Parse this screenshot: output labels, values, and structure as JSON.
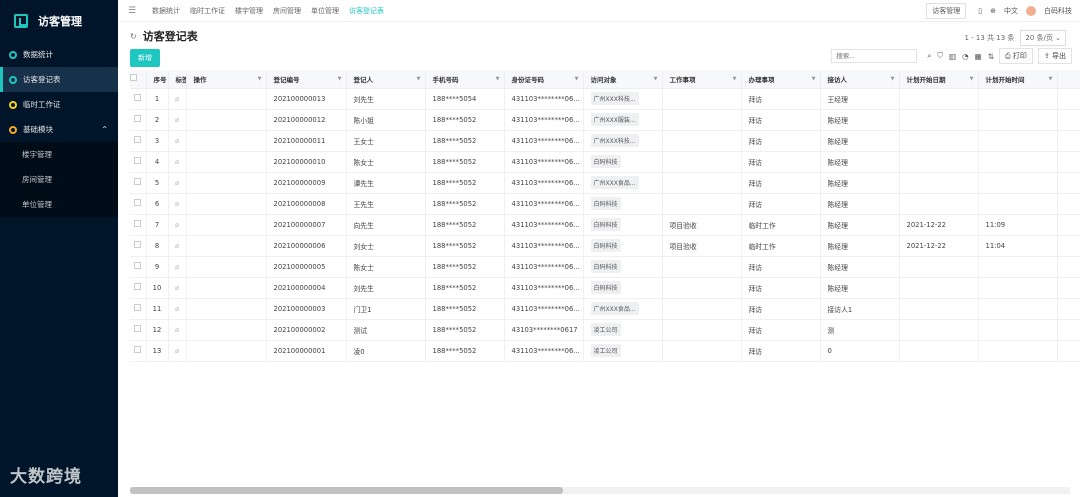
{
  "app": {
    "title": "访客管理",
    "watermark": "大数跨境"
  },
  "sidebar": {
    "items": [
      {
        "label": "数据统计"
      },
      {
        "label": "访客登记表"
      },
      {
        "label": "临时工作证"
      },
      {
        "label": "基础模块"
      }
    ],
    "subitems": [
      {
        "label": "楼宇管理"
      },
      {
        "label": "房间管理"
      },
      {
        "label": "单位管理"
      }
    ]
  },
  "topnav": {
    "tabs": [
      "数据统计",
      "临时工作证",
      "楼宇管理",
      "房间管理",
      "单位管理",
      "访客登记表"
    ],
    "active_tab": "访客登记表",
    "right_box": "访客管理",
    "lang": "中文",
    "company": "白码科技"
  },
  "page": {
    "title": "访客登记表",
    "new_button": "新增"
  },
  "pager": {
    "range": "1 - 13",
    "total": "共 13 条",
    "page_size": "20 条/页"
  },
  "toolbar": {
    "search_placeholder": "搜索...",
    "print": "打印",
    "export": "导出"
  },
  "table": {
    "headers": [
      "序号",
      "标签",
      "操作",
      "登记编号",
      "登记人",
      "手机号码",
      "身份证号码",
      "访问对象",
      "工作事项",
      "办理事项",
      "接访人",
      "计划开始日期",
      "计划开始时间",
      ""
    ],
    "rows": [
      {
        "idx": "1",
        "no": "202100000013",
        "name": "刘先生",
        "phone": "188****5054",
        "id": "431103********06...",
        "target": "广州XXX科技...",
        "work": "",
        "matter": "拜访",
        "host": "王经理",
        "date": "",
        "time": ""
      },
      {
        "idx": "2",
        "no": "202100000012",
        "name": "陈小姐",
        "phone": "188****5052",
        "id": "431103********06...",
        "target": "广州XXX服装...",
        "work": "",
        "matter": "拜访",
        "host": "陈经理",
        "date": "",
        "time": ""
      },
      {
        "idx": "3",
        "no": "202100000011",
        "name": "王女士",
        "phone": "188****5052",
        "id": "431103********06...",
        "target": "广州XXX科技...",
        "work": "",
        "matter": "拜访",
        "host": "陈经理",
        "date": "",
        "time": ""
      },
      {
        "idx": "4",
        "no": "202100000010",
        "name": "陈女士",
        "phone": "188****5052",
        "id": "431103********06...",
        "target": "白码科技",
        "work": "",
        "matter": "拜访",
        "host": "陈经理",
        "date": "",
        "time": ""
      },
      {
        "idx": "5",
        "no": "202100000009",
        "name": "谭先生",
        "phone": "188****5052",
        "id": "431103********06...",
        "target": "广州XXX食品...",
        "work": "",
        "matter": "拜访",
        "host": "陈经理",
        "date": "",
        "time": ""
      },
      {
        "idx": "6",
        "no": "202100000008",
        "name": "王先生",
        "phone": "188****5052",
        "id": "431103********06...",
        "target": "白码科技",
        "work": "",
        "matter": "拜访",
        "host": "陈经理",
        "date": "",
        "time": ""
      },
      {
        "idx": "7",
        "no": "202100000007",
        "name": "向先生",
        "phone": "188****5052",
        "id": "431103********06...",
        "target": "白码科技",
        "work": "项目验收",
        "matter": "临时工作",
        "host": "陈经理",
        "date": "2021-12-22",
        "time": "11:09"
      },
      {
        "idx": "8",
        "no": "202100000006",
        "name": "刘女士",
        "phone": "188****5052",
        "id": "431103********06...",
        "target": "白码科技",
        "work": "项目验收",
        "matter": "临时工作",
        "host": "陈经理",
        "date": "2021-12-22",
        "time": "11:04"
      },
      {
        "idx": "9",
        "no": "202100000005",
        "name": "陈女士",
        "phone": "188****5052",
        "id": "431103********06...",
        "target": "白码科技",
        "work": "",
        "matter": "拜访",
        "host": "陈经理",
        "date": "",
        "time": ""
      },
      {
        "idx": "10",
        "no": "202100000004",
        "name": "刘先生",
        "phone": "188****5052",
        "id": "431103********06...",
        "target": "白码科技",
        "work": "",
        "matter": "拜访",
        "host": "陈经理",
        "date": "",
        "time": ""
      },
      {
        "idx": "11",
        "no": "202100000003",
        "name": "门卫1",
        "phone": "188****5052",
        "id": "431103********06...",
        "target": "广州XXX食品...",
        "work": "",
        "matter": "拜访",
        "host": "接访人1",
        "date": "",
        "time": ""
      },
      {
        "idx": "12",
        "no": "202100000002",
        "name": "测试",
        "phone": "188****5052",
        "id": "43103********0617",
        "target": "凌工公司",
        "work": "",
        "matter": "拜访",
        "host": "测",
        "date": "",
        "time": ""
      },
      {
        "idx": "13",
        "no": "202100000001",
        "name": "凌0",
        "phone": "188****5052",
        "id": "431103********06...",
        "target": "凌工公司",
        "work": "",
        "matter": "拜访",
        "host": "0",
        "date": "",
        "time": ""
      }
    ]
  }
}
